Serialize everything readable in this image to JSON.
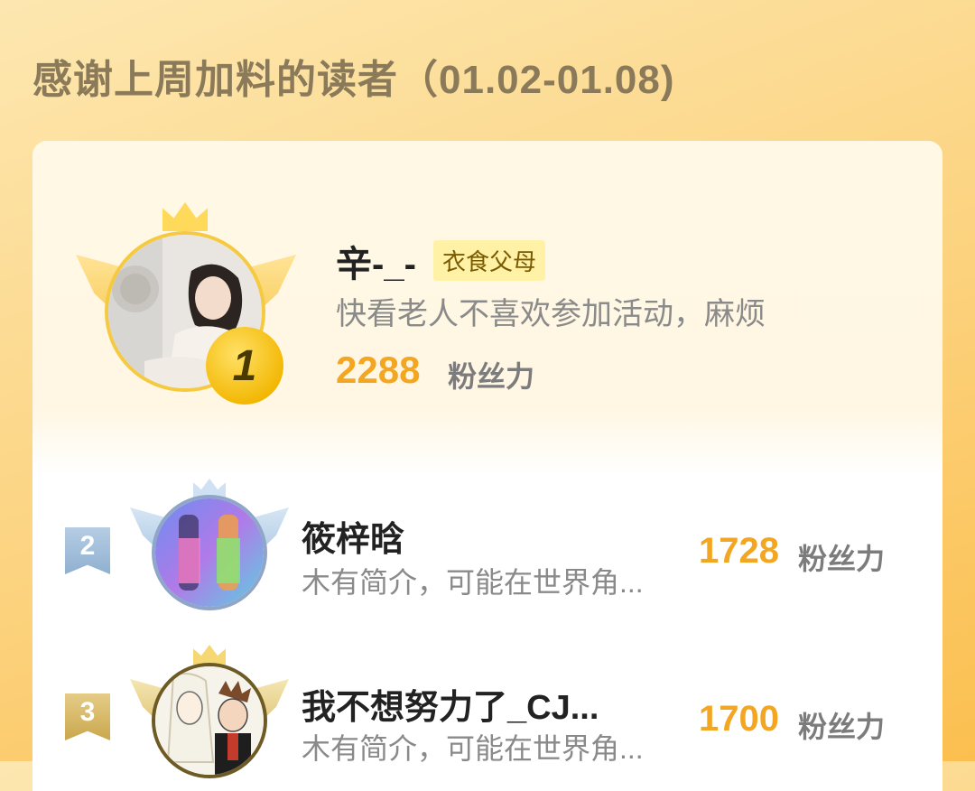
{
  "page": {
    "title": "感谢上周加料的读者（01.02-01.08)"
  },
  "colors": {
    "accent": "#f2a621",
    "gold": "#f2b600",
    "silver": "#8fb0d0",
    "bronze": "#c9a74d"
  },
  "ranking": [
    {
      "rank": "1",
      "name": "辛-_-",
      "tag": "衣食父母",
      "bio": "快看老人不喜欢参加活动，麻烦",
      "score": "2288",
      "score_label": "粉丝力"
    },
    {
      "rank": "2",
      "name": "筱梓晗",
      "bio": "木有简介，可能在世界角...",
      "score": "1728",
      "score_label": "粉丝力"
    },
    {
      "rank": "3",
      "name": "我不想努力了_CJ...",
      "bio": "木有简介，可能在世界角...",
      "score": "1700",
      "score_label": "粉丝力"
    }
  ]
}
